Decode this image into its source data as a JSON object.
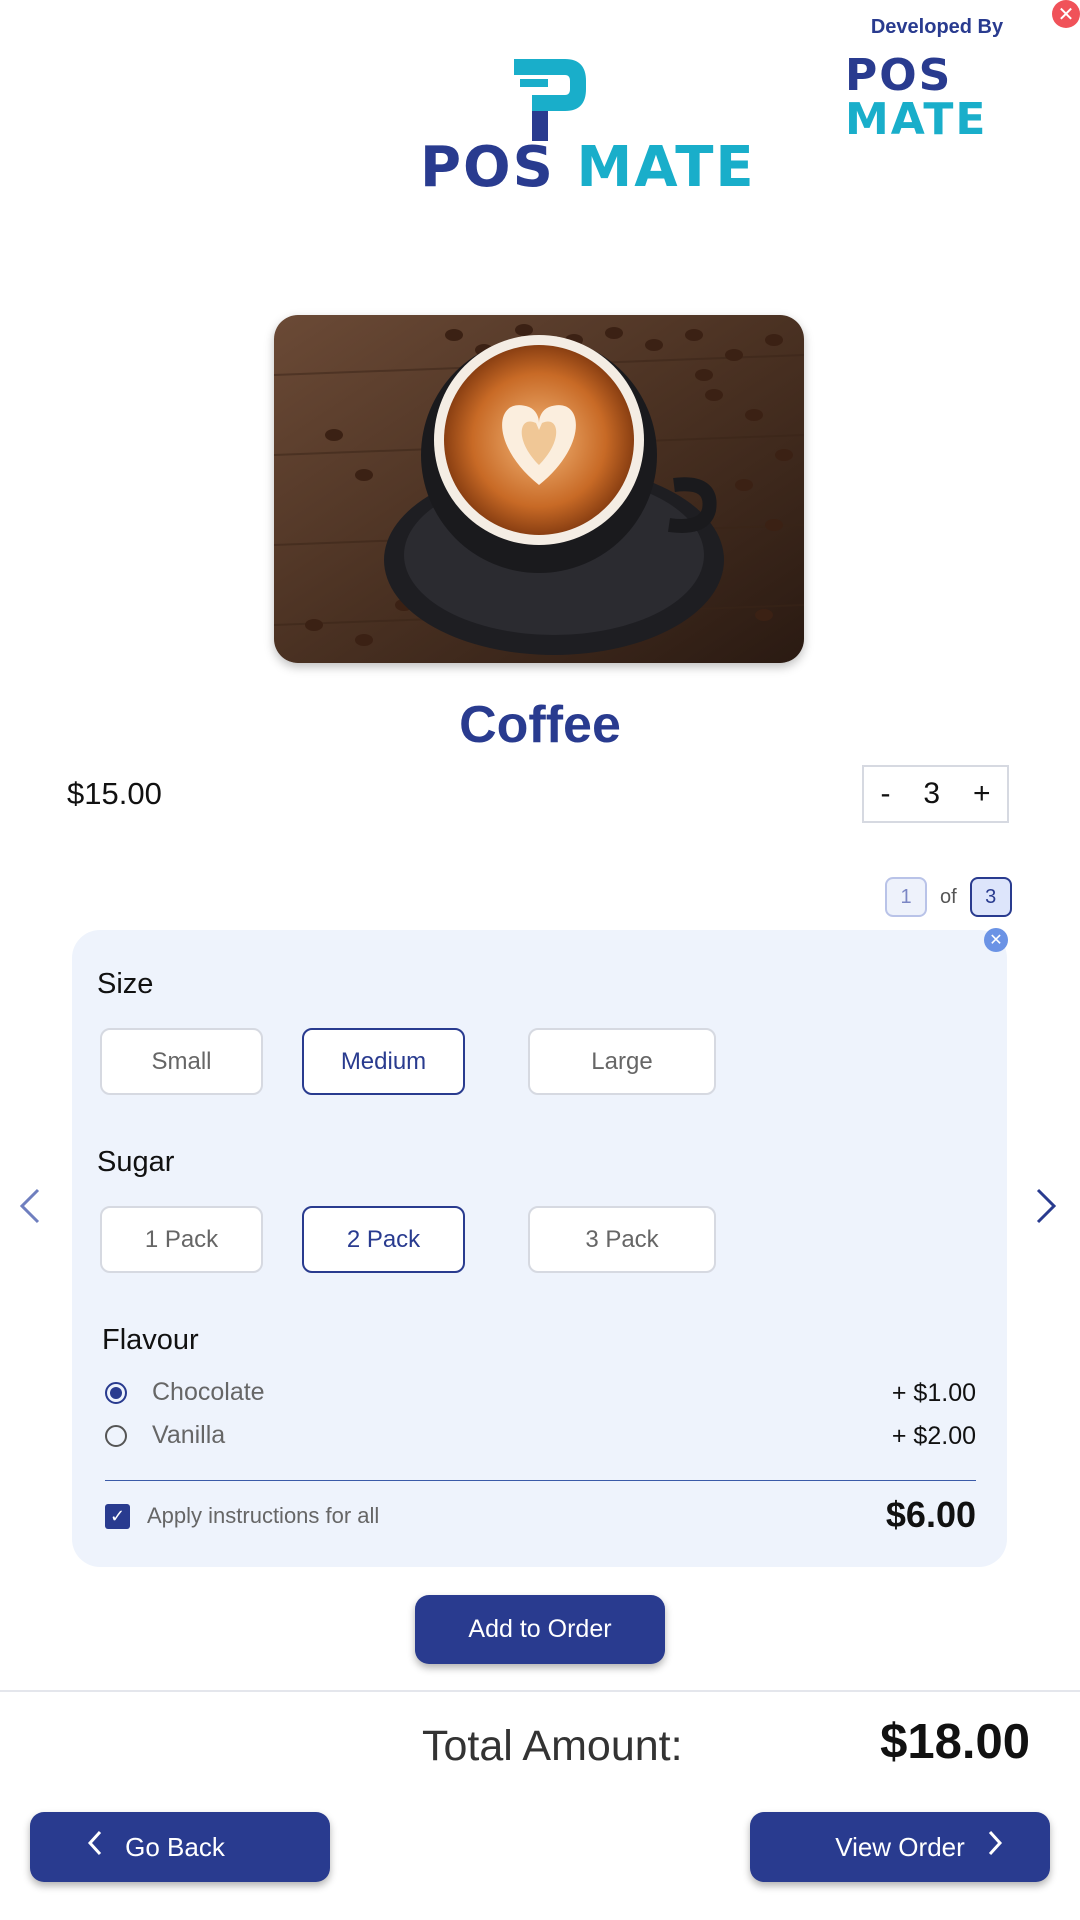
{
  "header": {
    "developed_by": "Developed By",
    "dev_logo": {
      "pos": "POS",
      "mate": "MATE"
    },
    "main_logo": {
      "pos": "POS",
      "mate": "MATE"
    },
    "close_icon": "close-icon"
  },
  "product": {
    "name": "Coffee",
    "price": "$15.00",
    "image_alt": "coffee-cup-image"
  },
  "quantity": {
    "minus": "-",
    "value": "3",
    "plus": "+"
  },
  "pager": {
    "current": "1",
    "of": "of",
    "total": "3"
  },
  "options": {
    "size": {
      "title": "Size",
      "choices": [
        "Small",
        "Medium",
        "Large"
      ],
      "selected": "Medium"
    },
    "sugar": {
      "title": "Sugar",
      "choices": [
        "1 Pack",
        "2 Pack",
        "3 Pack"
      ],
      "selected": "2 Pack"
    },
    "flavour": {
      "title": "Flavour",
      "items": [
        {
          "label": "Chocolate",
          "price": "+ $1.00",
          "selected": true
        },
        {
          "label": "Vanilla",
          "price": "+ $2.00",
          "selected": false
        }
      ]
    },
    "apply_all": {
      "label": "Apply instructions for all",
      "checked": true
    },
    "card_total": "$6.00"
  },
  "actions": {
    "add_to_order": "Add to Order",
    "total_label": "Total Amount:",
    "total_value": "$18.00",
    "go_back": "Go Back",
    "view_order": "View Order"
  },
  "colors": {
    "brand_navy": "#293b8f",
    "brand_teal": "#19aeca",
    "card_bg": "#eef3fc",
    "close_red": "#f05259"
  }
}
